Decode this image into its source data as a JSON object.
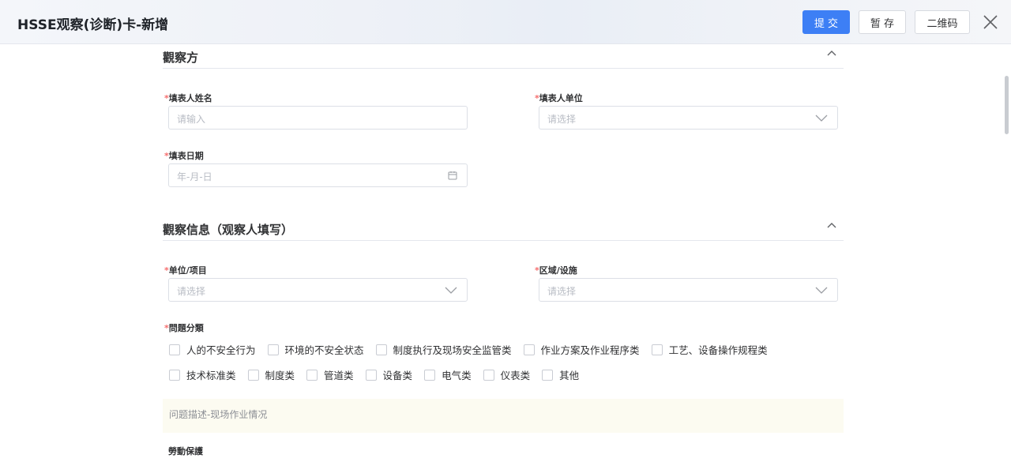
{
  "header": {
    "title": "HSSE观察(诊断)卡-新增",
    "submit_label": "提 交",
    "save_label": "暂 存",
    "qr_label": "二维码"
  },
  "sections": {
    "observer": {
      "title": "觀察方"
    },
    "info": {
      "title": "觀察信息（观察人填写）"
    }
  },
  "fields": {
    "filler_name": {
      "label": "填表人姓名",
      "placeholder": "请输入"
    },
    "filler_unit": {
      "label": "填表人单位",
      "placeholder": "请选择"
    },
    "filler_date": {
      "label": "填表日期",
      "placeholder": "年-月-日"
    },
    "unit_project": {
      "label": "单位/项目",
      "placeholder": "请选择"
    },
    "area_facility": {
      "label": "区域/设施",
      "placeholder": "请选择"
    },
    "issue_category": {
      "label": "問題分類"
    }
  },
  "required_mark": "*",
  "categories_row1": [
    "人的不安全行为",
    "环境的不安全状态",
    "制度执行及现场安全监管类",
    "作业方案及作业程序类",
    "工艺、设备操作规程类"
  ],
  "categories_row2": [
    "技术标准类",
    "制度类",
    "管道类",
    "设备类",
    "电气类",
    "仪表类",
    "其他"
  ],
  "description": {
    "label": "问题描述-现场作业情况"
  },
  "next_label": "勞動保護",
  "colors": {
    "primary": "#3d7ff5",
    "required": "#f56c6c"
  },
  "icons": {
    "close": "close-icon",
    "collapse": "chevron-up-icon",
    "select": "chevron-down-icon",
    "date": "calendar-icon"
  }
}
